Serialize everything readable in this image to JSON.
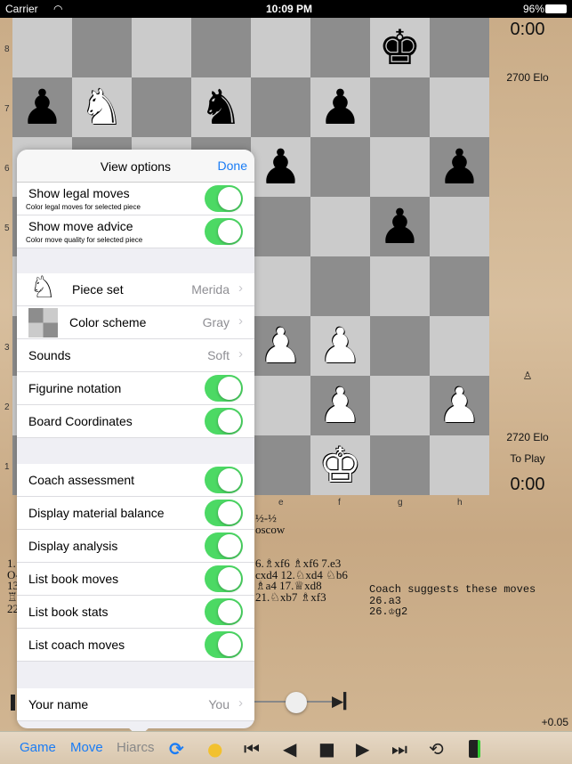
{
  "status": {
    "carrier": "Carrier",
    "time": "10:09 PM",
    "battery": "96%"
  },
  "board": {
    "squares": [
      [
        "",
        "",
        "",
        "",
        "",
        "",
        "bk",
        ""
      ],
      [
        "bp",
        "wn",
        "",
        "bn",
        "",
        "bp",
        "",
        ""
      ],
      [
        "",
        "",
        "",
        "",
        "bp",
        "",
        "",
        "bp"
      ],
      [
        "",
        "",
        "",
        "",
        "",
        "",
        "bp",
        ""
      ],
      [
        "",
        "",
        "",
        "",
        "",
        "",
        "",
        ""
      ],
      [
        "",
        "",
        "",
        "",
        "wp",
        "wp",
        "",
        ""
      ],
      [
        "",
        "",
        "",
        "",
        "",
        "wp",
        "",
        "wp"
      ],
      [
        "",
        "",
        "",
        "",
        "",
        "wk",
        "",
        ""
      ]
    ],
    "ranks": [
      "8",
      "7",
      "6",
      "5",
      "4",
      "3",
      "2",
      "1"
    ],
    "files": [
      "e",
      "f",
      "g",
      "h"
    ],
    "colors": {
      "light": "#cbcbcb",
      "dark": "#8d8d8d"
    }
  },
  "side": {
    "top_clock": "0:00",
    "top_elo": "2700 Elo",
    "material": "♙",
    "bottom_elo": "2720 Elo",
    "to_play": "To Play",
    "bottom_clock": "0:00",
    "eval": "+0.05"
  },
  "game": {
    "result": "½-½",
    "site": "oscow",
    "left_lines": [
      "1.",
      "O-",
      "13",
      "♖",
      "22"
    ],
    "move_lines": [
      "6.♗xf6 ♗xf6 7.e3",
      "cxd4 12.♘xd4 ♘b6",
      "♗a4 17.♕xd8",
      "21.♘xb7 ♗xf3"
    ],
    "coach": [
      "Coach suggests these moves",
      "26.a3",
      "26.♔g2"
    ]
  },
  "popover": {
    "title": "View options",
    "done": "Done",
    "section1": [
      {
        "label": "Show legal moves",
        "sub": "Color legal moves for selected piece",
        "on": true
      },
      {
        "label": "Show move advice",
        "sub": "Color move quality for selected piece",
        "on": true
      }
    ],
    "piece_set": {
      "label": "Piece set",
      "value": "Merida"
    },
    "color_scheme": {
      "label": "Color scheme",
      "value": "Gray"
    },
    "sounds": {
      "label": "Sounds",
      "value": "Soft"
    },
    "figurine": {
      "label": "Figurine notation",
      "on": true
    },
    "coords": {
      "label": "Board Coordinates",
      "on": true
    },
    "section3": [
      {
        "label": "Coach assessment",
        "on": true
      },
      {
        "label": "Display material balance",
        "on": true
      },
      {
        "label": "Display analysis",
        "on": true
      },
      {
        "label": "List book moves",
        "on": true
      },
      {
        "label": "List book stats",
        "on": true
      },
      {
        "label": "List coach moves",
        "on": true
      }
    ],
    "your_name": {
      "label": "Your name",
      "value": "You"
    }
  },
  "toolbar": {
    "game": "Game",
    "move": "Move",
    "engine": "Hiarcs",
    "accent": "#1a7cf5"
  }
}
